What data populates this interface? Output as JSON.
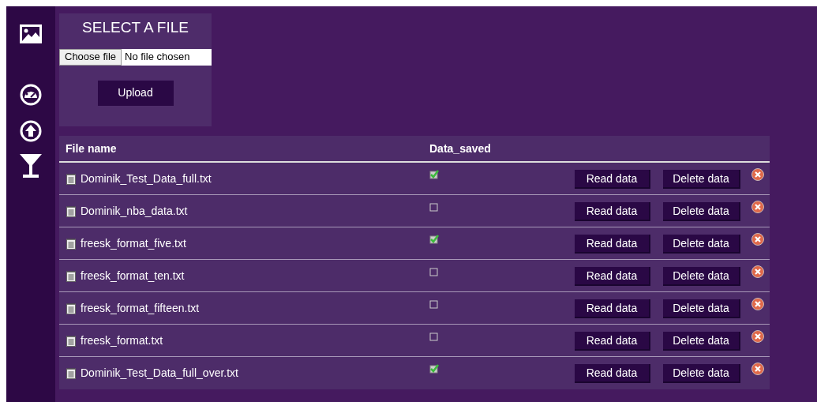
{
  "upload": {
    "title": "SELECT A FILE",
    "choose_button": "Choose file",
    "file_status": "No file chosen",
    "upload_button": "Upload"
  },
  "table": {
    "columns": [
      "File name",
      "Data_saved"
    ],
    "rows": [
      {
        "file_name": "Dominik_Test_Data_full.txt",
        "data_saved": true,
        "read_button": "Read data",
        "delete_button": "Delete data"
      },
      {
        "file_name": "Dominik_nba_data.txt",
        "data_saved": false,
        "read_button": "Read data",
        "delete_button": "Delete data"
      },
      {
        "file_name": "freesk_format_five.txt",
        "data_saved": true,
        "read_button": "Read data",
        "delete_button": "Delete data"
      },
      {
        "file_name": "freesk_format_ten.txt",
        "data_saved": false,
        "read_button": "Read data",
        "delete_button": "Delete data"
      },
      {
        "file_name": "freesk_format_fifteen.txt",
        "data_saved": false,
        "read_button": "Read data",
        "delete_button": "Delete data"
      },
      {
        "file_name": "freesk_format.txt",
        "data_saved": false,
        "read_button": "Read data",
        "delete_button": "Delete data"
      },
      {
        "file_name": "Dominik_Test_Data_full_over.txt",
        "data_saved": true,
        "read_button": "Read data",
        "delete_button": "Delete data"
      }
    ]
  }
}
